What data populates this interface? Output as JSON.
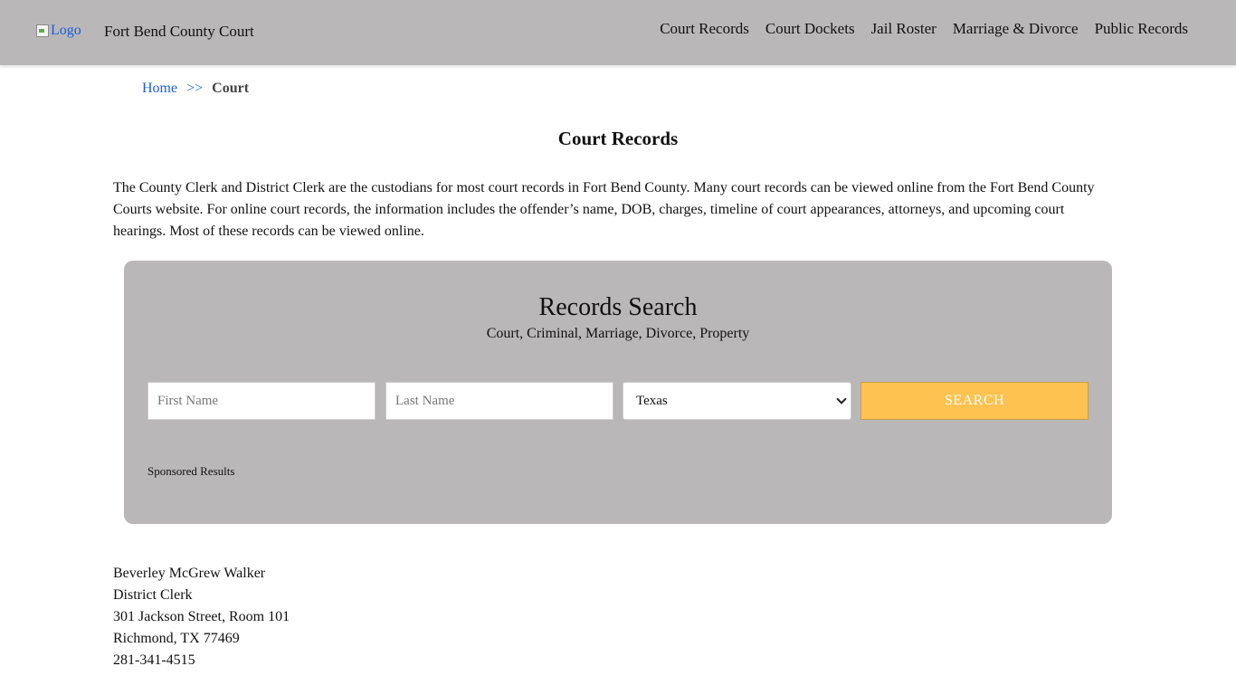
{
  "header": {
    "logo_alt": "Logo",
    "site_title": "Fort Bend County Court",
    "nav": [
      {
        "label": "Court Records"
      },
      {
        "label": "Court Dockets"
      },
      {
        "label": "Jail Roster"
      },
      {
        "label": "Marriage & Divorce"
      },
      {
        "label": "Public Records"
      }
    ]
  },
  "breadcrumb": {
    "home": "Home",
    "separator": ">>",
    "current": "Court"
  },
  "main": {
    "title": "Court Records",
    "intro": "The County Clerk and District Clerk are the custodians for most court records in Fort Bend County. Many court records can be viewed online from the Fort Bend County Courts website. For online court records, the information includes the offender’s name, DOB, charges, timeline of court appearances, attorneys, and upcoming court hearings. Most of these records can be viewed online."
  },
  "search": {
    "title": "Records Search",
    "subtitle": "Court, Criminal, Marriage, Divorce, Property",
    "first_name_placeholder": "First Name",
    "last_name_placeholder": "Last Name",
    "state_selected": "Texas",
    "button_label": "SEARCH",
    "sponsored": "Sponsored Results",
    "colors": {
      "panel": "#b9b7b8",
      "button": "#fdc24f"
    }
  },
  "contact": {
    "name": "Beverley McGrew Walker",
    "role": "District Clerk",
    "street": "301 Jackson Street, Room 101",
    "city": "Richmond, TX 77469",
    "phone": "281-341-4515"
  }
}
